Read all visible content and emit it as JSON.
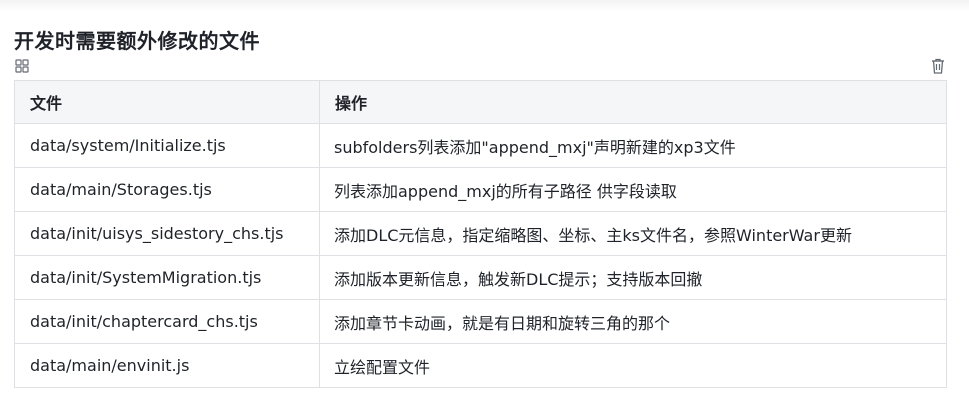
{
  "document": {
    "title": "开发时需要额外修改的文件"
  },
  "toolbar": {
    "left_icon": "grid-icon",
    "right_icon": "trash-icon"
  },
  "table": {
    "headers": [
      "文件",
      "操作"
    ],
    "rows": [
      [
        "data/system/Initialize.tjs",
        "subfolders列表添加\"append_mxj\"声明新建的xp3文件"
      ],
      [
        "data/main/Storages.tjs",
        "列表添加append_mxj的所有子路径 供字段读取"
      ],
      [
        "data/init/uisys_sidestory_chs.tjs",
        "添加DLC元信息，指定缩略图、坐标、主ks文件名，参照WinterWar更新"
      ],
      [
        "data/init/SystemMigration.tjs",
        "添加版本更新信息，触发新DLC提示；支持版本回撤"
      ],
      [
        "data/init/chaptercard_chs.tjs",
        "添加章节卡动画，就是有日期和旋转三角的那个"
      ],
      [
        "data/main/envinit.js",
        "立绘配置文件"
      ]
    ]
  },
  "colors": {
    "header_bg": "#f5f6f7",
    "border": "#dee0e3",
    "text": "#1f2329"
  }
}
